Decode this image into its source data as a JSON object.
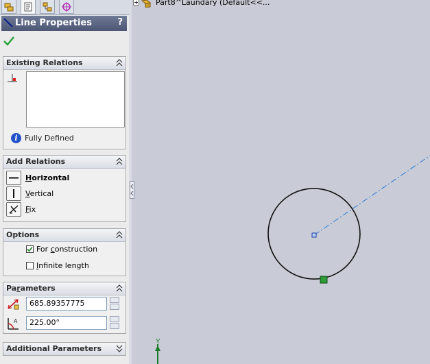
{
  "feature_tabs": [
    {
      "name": "FeatureManager"
    },
    {
      "name": "PropertyManager"
    },
    {
      "name": "ConfigurationManager"
    },
    {
      "name": "DimXpertManager"
    }
  ],
  "property_manager": {
    "title": "Line Properties",
    "help": "?"
  },
  "existing_relations": {
    "title": "Existing Relations",
    "status": "Fully Defined"
  },
  "add_relations": {
    "title": "Add Relations",
    "items": [
      {
        "label": "Horizontal",
        "mnemonic": "H",
        "rest": "orizontal",
        "icon": "horizontal-relation-icon"
      },
      {
        "label": "Vertical",
        "mnemonic": "V",
        "rest": "ertical",
        "icon": "vertical-relation-icon"
      },
      {
        "label": "Fix",
        "mnemonic": "F",
        "rest": "ix",
        "icon": "fix-relation-icon"
      }
    ]
  },
  "options": {
    "title": "Options",
    "for_construction": {
      "pre": "For ",
      "mnemonic": "c",
      "post": "onstruction",
      "checked": true
    },
    "infinite_length": {
      "mnemonic": "I",
      "post": "nfinite length",
      "checked": false
    }
  },
  "parameters": {
    "title": "Parameters",
    "title_pre": "Pa",
    "title_mnemonic": "r",
    "title_post": "ameters",
    "length": "685.89357775",
    "angle": "225.00°"
  },
  "additional_parameters": {
    "title": "Additional Parameters"
  },
  "graphics": {
    "tree_label": "Part8^Laundary  (Default<<...",
    "axis_label": "Y",
    "colors": {
      "background": "#c9ccd6",
      "circle": "#111111",
      "construction_line": "#2b7bd8",
      "selected_point": "#2e9b39",
      "axis": "#1b7a26"
    }
  }
}
